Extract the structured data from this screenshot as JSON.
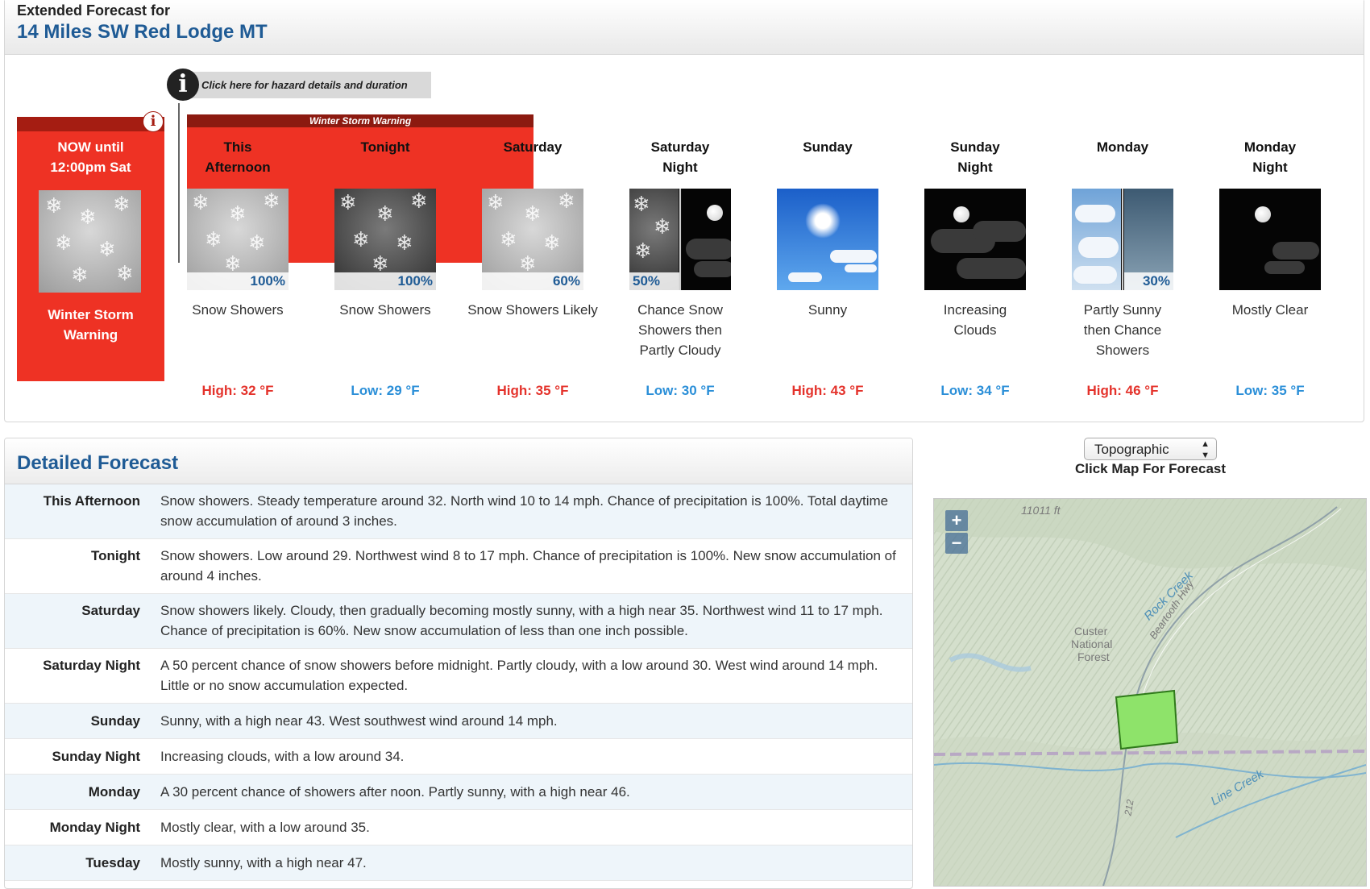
{
  "header": {
    "title": "Extended Forecast for",
    "location": "14 Miles SW Red Lodge MT"
  },
  "hazard": {
    "link_label": "Click here for hazard details and duration",
    "band_label": "Winter Storm Warning",
    "now_line1": "NOW until",
    "now_line2": "12:00pm Sat",
    "now_label_line1": "Winter Storm",
    "now_label_line2": "Warning",
    "info_icon": "info-icon"
  },
  "periods": [
    {
      "name": "This\nAfternoon",
      "icon": "snow-showers",
      "pop": "100%",
      "desc": "Snow Showers",
      "temp": "High: 32 °F",
      "type": "hi"
    },
    {
      "name": "Tonight",
      "icon": "snow-showers-night",
      "pop": "100%",
      "desc": "Snow Showers",
      "temp": "Low: 29 °F",
      "type": "lo"
    },
    {
      "name": "Saturday",
      "icon": "snow-showers",
      "pop": "60%",
      "desc": "Snow Showers Likely",
      "temp": "High: 35 °F",
      "type": "hi"
    },
    {
      "name": "Saturday Night",
      "icon": "snow-then-partly-cloudy",
      "pop": "50%",
      "desc": "Chance Snow Showers then Partly Cloudy",
      "temp": "Low: 30 °F",
      "type": "lo"
    },
    {
      "name": "Sunday",
      "icon": "sunny",
      "pop": "",
      "desc": "Sunny",
      "temp": "High: 43 °F",
      "type": "hi"
    },
    {
      "name": "Sunday Night",
      "icon": "increasing-clouds",
      "pop": "",
      "desc": "Increasing Clouds",
      "temp": "Low: 34 °F",
      "type": "lo"
    },
    {
      "name": "Monday",
      "icon": "partly-sunny-then-showers",
      "pop": "30%",
      "desc": "Partly Sunny then Chance Showers",
      "temp": "High: 46 °F",
      "type": "hi"
    },
    {
      "name": "Monday Night",
      "icon": "mostly-clear",
      "pop": "",
      "desc": "Mostly Clear",
      "temp": "Low: 35 °F",
      "type": "lo"
    }
  ],
  "detailed": {
    "title": "Detailed Forecast",
    "rows": [
      {
        "label": "This Afternoon",
        "text": "Snow showers. Steady temperature around 32. North wind 10 to 14 mph. Chance of precipitation is 100%. Total daytime snow accumulation of around 3 inches."
      },
      {
        "label": "Tonight",
        "text": "Snow showers. Low around 29. Northwest wind 8 to 17 mph. Chance of precipitation is 100%. New snow accumulation of around 4 inches."
      },
      {
        "label": "Saturday",
        "text": "Snow showers likely. Cloudy, then gradually becoming mostly sunny, with a high near 35. Northwest wind 11 to 17 mph. Chance of precipitation is 60%. New snow accumulation of less than one inch possible."
      },
      {
        "label": "Saturday Night",
        "text": "A 50 percent chance of snow showers before midnight. Partly cloudy, with a low around 30. West wind around 14 mph. Little or no snow accumulation expected."
      },
      {
        "label": "Sunday",
        "text": "Sunny, with a high near 43. West southwest wind around 14 mph."
      },
      {
        "label": "Sunday Night",
        "text": "Increasing clouds, with a low around 34."
      },
      {
        "label": "Monday",
        "text": "A 30 percent chance of showers after noon. Partly sunny, with a high near 46."
      },
      {
        "label": "Monday Night",
        "text": "Mostly clear, with a low around 35."
      },
      {
        "label": "Tuesday",
        "text": "Mostly sunny, with a high near 47."
      }
    ]
  },
  "map": {
    "select_value": "Topographic",
    "caption": "Click Map For Forecast",
    "zoom_in": "+",
    "zoom_out": "−",
    "labels": {
      "elevation": "11011 ft",
      "forest1": "Custer",
      "forest2": "National",
      "forest3": "Forest",
      "creek1": "Rock Creek",
      "highway": "Beartooth Hwy",
      "creek2": "Line Creek",
      "route": "212"
    }
  },
  "colors": {
    "brand_blue": "#1f5b95",
    "warning_red": "#ee3224",
    "high_temp": "#e4322b",
    "low_temp": "#2b8fd8"
  }
}
